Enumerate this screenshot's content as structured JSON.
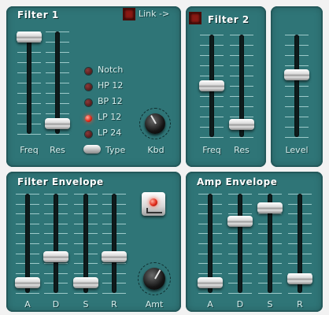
{
  "filter1": {
    "title": "Filter 1",
    "freq_label": "Freq",
    "res_label": "Res",
    "freq_value": 1.0,
    "res_value": 0.05,
    "modes": [
      "Notch",
      "HP 12",
      "BP 12",
      "LP 12",
      "LP 24"
    ],
    "active_mode": "LP 12",
    "type_label": "Type",
    "kbd_label": "Kbd"
  },
  "link": {
    "label": "Link ->"
  },
  "filter2": {
    "title": "Filter 2",
    "freq_label": "Freq",
    "res_label": "Res",
    "freq_value": 0.5,
    "res_value": 0.08
  },
  "level": {
    "label": "Level",
    "value": 0.62
  },
  "filter_envelope": {
    "title": "Filter Envelope",
    "sliders": [
      {
        "label": "A",
        "value": 0.05
      },
      {
        "label": "D",
        "value": 0.35
      },
      {
        "label": "S",
        "value": 0.05
      },
      {
        "label": "R",
        "value": 0.35
      }
    ],
    "amt_label": "Amt"
  },
  "amp_envelope": {
    "title": "Amp Envelope",
    "sliders": [
      {
        "label": "A",
        "value": 0.05
      },
      {
        "label": "D",
        "value": 0.75
      },
      {
        "label": "S",
        "value": 0.9
      },
      {
        "label": "R",
        "value": 0.1
      }
    ]
  },
  "colors": {
    "panel": "#2f7577",
    "led_on": "#e22a1a",
    "led_off": "#5a1a1a"
  },
  "icons": {
    "link_button": "square-led-button",
    "env_invert": "envelope-invert-button"
  }
}
